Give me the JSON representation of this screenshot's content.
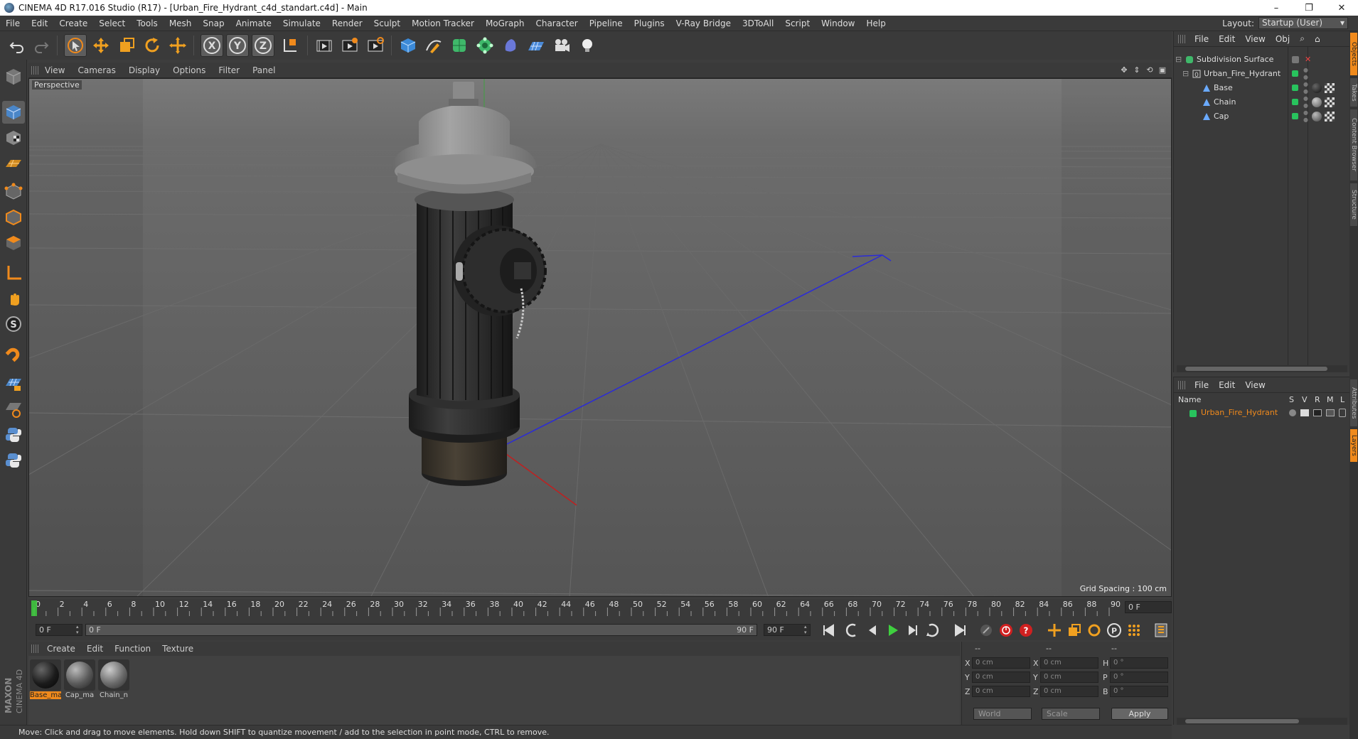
{
  "window": {
    "title": "CINEMA 4D R17.016 Studio (R17) - [Urban_Fire_Hydrant_c4d_standart.c4d] - Main",
    "controls": [
      "–",
      "❐",
      "✕"
    ]
  },
  "menubar": {
    "items": [
      "File",
      "Edit",
      "Create",
      "Select",
      "Tools",
      "Mesh",
      "Snap",
      "Animate",
      "Simulate",
      "Render",
      "Sculpt",
      "Motion Tracker",
      "MoGraph",
      "Character",
      "Pipeline",
      "Plugins",
      "V-Ray Bridge",
      "3DToAll",
      "Script",
      "Window",
      "Help"
    ],
    "layout_label": "Layout:",
    "layout_value": "Startup (User)"
  },
  "toolbar": {
    "icons": [
      "undo-icon",
      "redo-icon",
      "live-select-icon",
      "move-icon",
      "scale-icon",
      "rotate-icon",
      "recent-tool-icon",
      "x-axis-icon",
      "y-axis-icon",
      "z-axis-icon",
      "coordinate-system-icon",
      "render-view-icon",
      "render-picture-viewer-icon",
      "edit-render-settings-icon",
      "cube-icon",
      "pen-spline-icon",
      "subdivision-icon",
      "array-icon",
      "deformer-icon",
      "floor-icon",
      "camera-icon",
      "light-icon"
    ]
  },
  "leftbar": {
    "icons": [
      "make-editable-icon",
      "model-mode-icon",
      "texture-mode-icon",
      "workplane-icon",
      "points-mode-icon",
      "edges-mode-icon",
      "polygons-mode-icon",
      "axis-mode-icon",
      "tweak-icon",
      "solo-icon",
      "snap-icon",
      "lock-workplane-icon",
      "planar-workplane-icon",
      "python-icon",
      "python-icon-2"
    ],
    "brand_line1": "MAXON",
    "brand_line2": "CINEMA 4D"
  },
  "viewport": {
    "menu": [
      "View",
      "Cameras",
      "Display",
      "Options",
      "Filter",
      "Panel"
    ],
    "label": "Perspective",
    "grid_spacing": "Grid Spacing : 100 cm"
  },
  "timeline": {
    "ticks": [
      "0",
      "2",
      "4",
      "6",
      "8",
      "10",
      "12",
      "14",
      "16",
      "18",
      "20",
      "22",
      "24",
      "26",
      "28",
      "30",
      "32",
      "34",
      "36",
      "38",
      "40",
      "42",
      "44",
      "46",
      "48",
      "50",
      "52",
      "54",
      "56",
      "58",
      "60",
      "62",
      "64",
      "66",
      "68",
      "70",
      "72",
      "74",
      "76",
      "78",
      "80",
      "82",
      "84",
      "86",
      "88",
      "90"
    ],
    "current_frame": "0 F",
    "current_position": 0
  },
  "transport": {
    "start_field": "0 F",
    "range_start": "0 F",
    "range_end": "90 F",
    "end_field": "90 F",
    "buttons": [
      "goto-start-icon",
      "prev-key-icon",
      "prev-frame-icon",
      "play-icon",
      "next-frame-icon",
      "next-key-icon",
      "goto-end-icon",
      "loop-icon",
      "record-icon",
      "autokey-icon",
      "keyframe-selection-icon",
      "key-position-icon",
      "key-scale-icon",
      "key-rotation-icon",
      "key-param-icon",
      "key-pla-icon",
      "timeline-icon"
    ]
  },
  "materials": {
    "menu": [
      "Create",
      "Edit",
      "Function",
      "Texture"
    ],
    "items": [
      {
        "name": "Base_ma",
        "selected": true,
        "color": "#1b1b1b"
      },
      {
        "name": "Cap_ma",
        "selected": false,
        "color": "#5a5a5a"
      },
      {
        "name": "Chain_n",
        "selected": false,
        "color": "#6a6a6a"
      }
    ]
  },
  "coordinates": {
    "headers": [
      "--",
      "--",
      "--"
    ],
    "rows": [
      {
        "a": "X",
        "av": "0 cm",
        "b": "X",
        "bv": "0 cm",
        "c": "H",
        "cv": "0 °"
      },
      {
        "a": "Y",
        "av": "0 cm",
        "b": "Y",
        "bv": "0 cm",
        "c": "P",
        "cv": "0 °"
      },
      {
        "a": "Z",
        "av": "0 cm",
        "b": "Z",
        "bv": "0 cm",
        "c": "B",
        "cv": "0 °"
      }
    ],
    "space": "World",
    "mode": "Scale",
    "apply": "Apply"
  },
  "status": "Move: Click and drag to move elements. Hold down SHIFT to quantize movement / add to the selection in point mode, CTRL to remove.",
  "object_manager": {
    "menu": [
      "File",
      "Edit",
      "View",
      "Obj"
    ],
    "objects": [
      {
        "name": "Subdivision Surface",
        "icon": "subdivision-icon",
        "color": "#4bcf7a",
        "indent": 0
      },
      {
        "name": "Urban_Fire_Hydrant",
        "icon": "null-object-icon",
        "color": "#4bcf7a",
        "indent": 1
      },
      {
        "name": "Base",
        "icon": "polygon-object-icon",
        "color": "#4bcf7a",
        "indent": 2
      },
      {
        "name": "Chain",
        "icon": "polygon-object-icon",
        "color": "#4bcf7a",
        "indent": 2
      },
      {
        "name": "Cap",
        "icon": "polygon-object-icon",
        "color": "#4bcf7a",
        "indent": 2
      }
    ]
  },
  "layer_manager": {
    "menu": [
      "File",
      "Edit",
      "View"
    ],
    "columns": [
      "Name",
      "S",
      "V",
      "R",
      "M",
      "L"
    ],
    "layer": {
      "name": "Urban_Fire_Hydrant",
      "color": "#28c35d"
    }
  },
  "side_tabs": [
    "Objects",
    "Takes",
    "Content Browser",
    "Structure",
    "Attributes",
    "Layers"
  ],
  "colors": {
    "accent": "#f08a1c",
    "green_tag": "#28c35d",
    "panel": "#3a3a3a"
  }
}
